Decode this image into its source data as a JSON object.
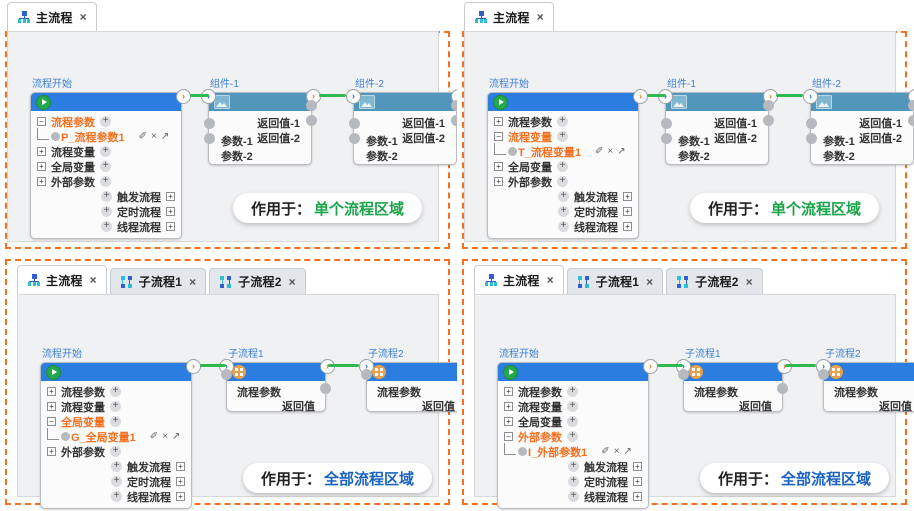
{
  "colors": {
    "frame_dashed": "#f4701f",
    "start_header": "#2b7de0",
    "component_header": "#5396bb",
    "subflow_header": "#2b7de0",
    "link": "#2fb84f",
    "accent_orange": "#f4701f",
    "title_blue": "#3b7fd4",
    "pill_green": "#1aa44a",
    "pill_blue": "#1a63c0",
    "canvas_bg": "#f0f1f3",
    "page_bg": "#6b7d8c"
  },
  "labels": {
    "tab_close": "×",
    "toggle_collapsed": "+",
    "toggle_expanded": "−",
    "plus": "+",
    "edit_icon": "✐",
    "delete_icon": "×",
    "goto_icon": "↗",
    "port_out": "›",
    "port_in": "›",
    "start_title": "流程开始",
    "scope_prefix": "作用于："
  },
  "tree": {
    "flow_param": "流程参数",
    "flow_var": "流程变量",
    "global_var": "全局变量",
    "external_param": "外部参数",
    "trigger_flow": "触发流程",
    "timer_flow": "定时流程",
    "thread_flow": "线程流程",
    "child_flow_param": "P_流程参数1",
    "child_flow_var": "T_流程变量1",
    "child_global_var": "G_全局变量1",
    "child_external_param": "I_外部参数1"
  },
  "node_labels": {
    "component_1": "组件-1",
    "component_2": "组件-2",
    "subflow_1": "子流程1",
    "subflow_2": "子流程2",
    "param_1": "参数-1",
    "param_2": "参数-2",
    "return_1": "返回值-1",
    "return_2": "返回值-2",
    "flow_param": "流程参数",
    "return_value": "返回值"
  },
  "panels": [
    {
      "id": "top-left",
      "tabs": [
        {
          "label": "主流程",
          "icon": "main-flow-icon",
          "active": true
        }
      ],
      "expanded_row": "flow_param",
      "child_name": "P_流程参数1",
      "node_kind": "component",
      "scope_value": "单个流程区域",
      "scope_color": "green",
      "frame_includes_tabs": false
    },
    {
      "id": "top-right",
      "tabs": [
        {
          "label": "主流程",
          "icon": "main-flow-icon",
          "active": true
        }
      ],
      "expanded_row": "flow_var",
      "child_name": "T_流程变量1",
      "node_kind": "component",
      "scope_value": "单个流程区域",
      "scope_color": "green",
      "frame_includes_tabs": false
    },
    {
      "id": "bottom-left",
      "tabs": [
        {
          "label": "主流程",
          "icon": "main-flow-icon",
          "active": true
        },
        {
          "label": "子流程1",
          "icon": "sub-flow-icon",
          "active": false
        },
        {
          "label": "子流程2",
          "icon": "sub-flow-icon",
          "active": false
        }
      ],
      "expanded_row": "global_var",
      "child_name": "G_全局变量1",
      "node_kind": "subflow",
      "scope_value": "全部流程区域",
      "scope_color": "blue",
      "frame_includes_tabs": true
    },
    {
      "id": "bottom-right",
      "tabs": [
        {
          "label": "主流程",
          "icon": "main-flow-icon",
          "active": true
        },
        {
          "label": "子流程1",
          "icon": "sub-flow-icon",
          "active": false
        },
        {
          "label": "子流程2",
          "icon": "sub-flow-icon",
          "active": false
        }
      ],
      "expanded_row": "external_param",
      "child_name": "I_外部参数1",
      "node_kind": "subflow",
      "scope_value": "全部流程区域",
      "scope_color": "blue",
      "frame_includes_tabs": true
    }
  ]
}
